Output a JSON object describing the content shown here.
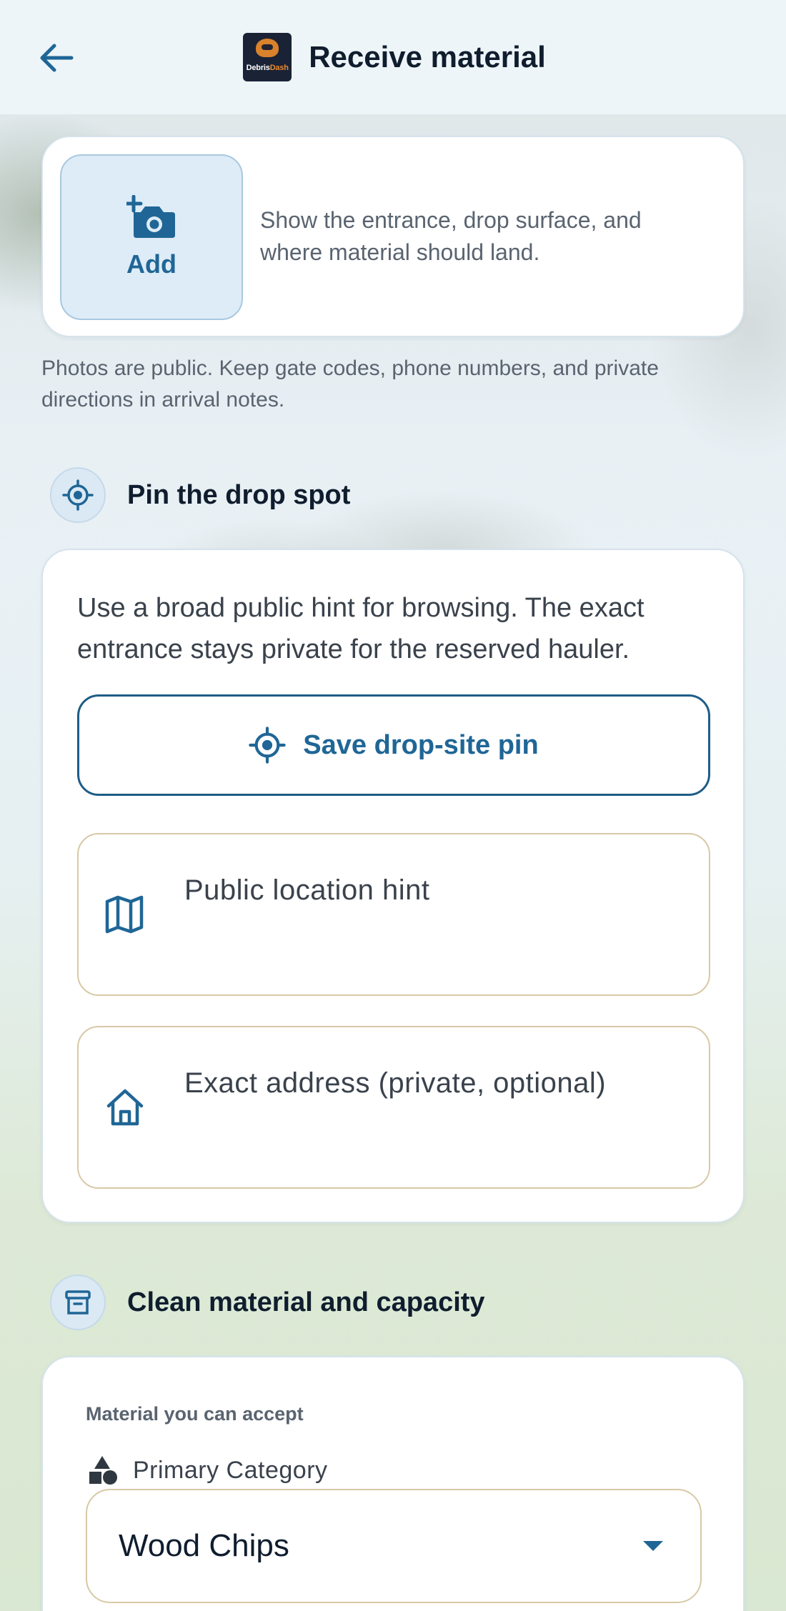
{
  "header": {
    "title": "Receive material",
    "back_icon": "arrow-left-icon",
    "logo_text_primary": "Debris",
    "logo_text_accent": "Dash"
  },
  "photos": {
    "add_label": "Add",
    "hint": "Show the entrance, drop surface, and where material should land.",
    "public_note": "Photos are public. Keep gate codes, phone numbers, and private directions in arrival notes."
  },
  "pin_section": {
    "title": "Pin the drop spot",
    "description": "Use a broad public hint for browsing. The exact entrance stays private for the reserved hauler.",
    "save_pin_label": "Save drop-site pin",
    "public_hint_placeholder": "Public location hint",
    "exact_address_placeholder": "Exact address (private, optional)"
  },
  "material_section": {
    "title": "Clean material and capacity",
    "sublabel": "Material you can accept",
    "category_label": "Primary Category",
    "category_value": "Wood Chips"
  },
  "colors": {
    "accent": "#1f6696",
    "field_border": "#d8c9a6"
  }
}
